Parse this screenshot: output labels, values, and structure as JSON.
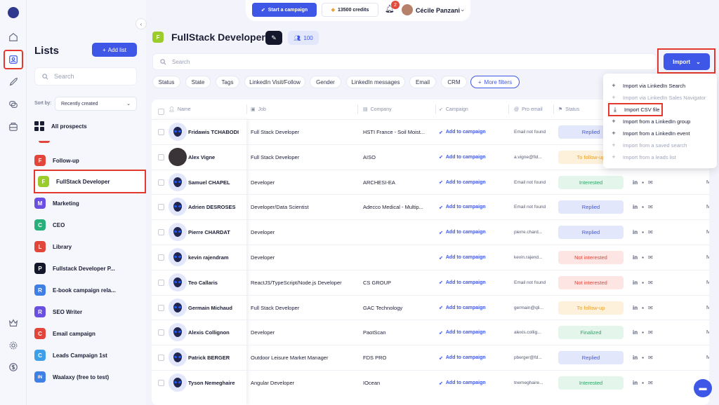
{
  "topbar": {
    "start_campaign": "Start a campaign",
    "credits": "13500 credits",
    "notifications_count": "2",
    "user_name": "Cécile Panzani"
  },
  "rail": {
    "icons": [
      "logo",
      "home-icon",
      "contacts-icon",
      "rocket-icon",
      "messages-icon",
      "inbox-icon",
      "crown-icon",
      "settings-icon",
      "dollar-icon"
    ],
    "highlighted": "contacts-icon"
  },
  "lists_panel": {
    "title": "Lists",
    "add_list": "Add list",
    "search_placeholder": "Search",
    "sort_label": "Sort by:",
    "sort_value": "Recently created",
    "all_prospects": "All prospects",
    "items": [
      {
        "badge": "F",
        "label": "Follow-up",
        "color": "#e2463b"
      },
      {
        "badge": "F",
        "label": "FullStack Developer",
        "color": "#9ccc2c"
      },
      {
        "badge": "M",
        "label": "Marketing",
        "color": "#6a4fe0"
      },
      {
        "badge": "C",
        "label": "CEO",
        "color": "#29b07a"
      },
      {
        "badge": "L",
        "label": "Library",
        "color": "#e2463b"
      },
      {
        "badge": "P",
        "label": "Fullstack Developer P...",
        "color": "#14162b"
      },
      {
        "badge": "R",
        "label": "E-book campaign rela...",
        "color": "#3f7fe6"
      },
      {
        "badge": "R",
        "label": "SEO Writer",
        "color": "#6a4fe0"
      },
      {
        "badge": "C",
        "label": "Email campaign",
        "color": "#e2463b"
      },
      {
        "badge": "C",
        "label": "Leads Campaign 1st",
        "color": "#3fa0ea"
      },
      {
        "badge": "IN",
        "label": "Waalaxy (free to test)",
        "color": "#3f7fe6"
      }
    ],
    "active_index": 1
  },
  "header": {
    "list_badge": "F",
    "title": "FullStack Developer",
    "people_count": "100",
    "search_placeholder": "Search",
    "import_label": "Import"
  },
  "filters": [
    "Status",
    "State",
    "Tags",
    "LinkedIn Visit/Follow",
    "Gender",
    "LinkedIn messages",
    "Email",
    "CRM",
    "More filters"
  ],
  "table": {
    "columns": [
      "Name",
      "Job",
      "Company",
      "Campaign",
      "Pro email",
      "Status"
    ],
    "rows": [
      {
        "name": "Fridawis TCHABODI",
        "job": "Full Stack Developer",
        "company": "HSTI France - Soil Moist...",
        "campaign": "Add to campaign",
        "email": "Email not found",
        "status": "Replied",
        "avatar": "alien"
      },
      {
        "name": "Alex Vigne",
        "job": "Full Stack Developer",
        "company": "AISO",
        "campaign": "Add to campaign",
        "email": "a.vigne@fid...",
        "status": "To follow-up",
        "avatar": "photo"
      },
      {
        "name": "Samuel CHAPEL",
        "job": "Developer",
        "company": "ARCHESI-EA",
        "campaign": "Add to campaign",
        "email": "Email not found",
        "status": "Interested",
        "avatar": "alien"
      },
      {
        "name": "Adrien DESROSES",
        "job": "Developer/Data Scientist",
        "company": "Adecco Medical - Multip...",
        "campaign": "Add to campaign",
        "email": "Email not found",
        "status": "Replied",
        "avatar": "alien"
      },
      {
        "name": "Pierre CHARDAT",
        "job": "Developer",
        "company": "",
        "campaign": "Add to campaign",
        "email": "pierre.chard...",
        "status": "Replied",
        "avatar": "alien"
      },
      {
        "name": "kevin rajendram",
        "job": "Developer",
        "company": "",
        "campaign": "Add to campaign",
        "email": "kevin.rajend...",
        "status": "Not interested",
        "avatar": "alien"
      },
      {
        "name": "Teo Callaris",
        "job": "ReactJS/TypeScript/Node.js Developer",
        "company": "CS GROUP",
        "campaign": "Add to campaign",
        "email": "Email not found",
        "status": "Not interested",
        "avatar": "alien"
      },
      {
        "name": "Germain Michaud",
        "job": "Full Stack Developer",
        "company": "GAC Technology",
        "campaign": "Add to campaign",
        "email": "germain@qli...",
        "status": "To follow-up",
        "avatar": "alien"
      },
      {
        "name": "Alexis Collignon",
        "job": "Developer",
        "company": "PaotScan",
        "campaign": "Add to campaign",
        "email": "alexis.collig...",
        "status": "Finalized",
        "avatar": "alien"
      },
      {
        "name": "Patrick BERGER",
        "job": "Outdoor Leisure Market Manager",
        "company": "FDS PRO",
        "campaign": "Add to campaign",
        "email": "pberger@fd...",
        "status": "Replied",
        "avatar": "alien"
      },
      {
        "name": "Tyson Nemeghaire",
        "job": "Angular Developer",
        "company": "IOcean",
        "campaign": "Add to campaign",
        "email": "tnemeghaire...",
        "status": "Interested",
        "avatar": "alien"
      }
    ],
    "tail_letter": "M"
  },
  "status_colors": {
    "Replied": {
      "bg": "#e3e7fb",
      "fg": "#3f57e6"
    },
    "To follow-up": {
      "bg": "#fdf1dc",
      "fg": "#e7a02a"
    },
    "Interested": {
      "bg": "#e4f6ec",
      "fg": "#2aa866"
    },
    "Not interested": {
      "bg": "#fde5e3",
      "fg": "#e2463b"
    },
    "Finalized": {
      "bg": "#e4f6ec",
      "fg": "#2aa866"
    }
  },
  "import_menu": [
    {
      "icon": "+",
      "label": "Import via LinkedIn Search",
      "disabled": false
    },
    {
      "icon": "+",
      "label": "Import via LinkedIn Sales Navigator",
      "disabled": true
    },
    {
      "icon": "download",
      "label": "Import CSV file",
      "disabled": false,
      "highlighted": true
    },
    {
      "icon": "+",
      "label": "Import from a LinkedIn group",
      "disabled": false
    },
    {
      "icon": "+",
      "label": "Import from a LinkedIn event",
      "disabled": false
    },
    {
      "icon": "+",
      "label": "Import from a saved search",
      "disabled": true
    },
    {
      "icon": "+",
      "label": "Import from a leads list",
      "disabled": true
    }
  ]
}
